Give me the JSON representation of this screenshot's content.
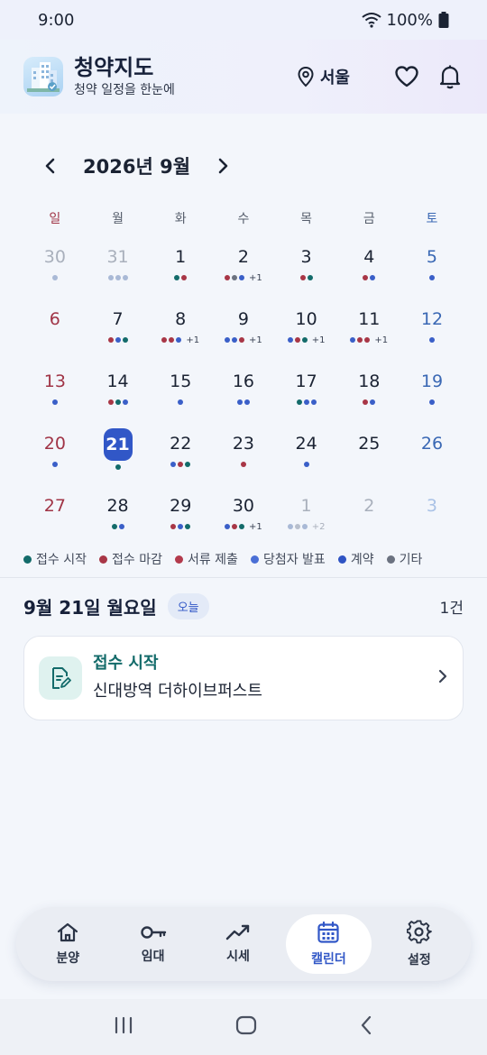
{
  "status": {
    "time": "9:00",
    "battery": "100%"
  },
  "header": {
    "title": "청약지도",
    "subtitle": "청약 일정을 한눈에",
    "location": "서울"
  },
  "calendar": {
    "month_label": "2026년 9월",
    "weekdays": [
      "일",
      "월",
      "화",
      "수",
      "목",
      "금",
      "토"
    ],
    "weeks": [
      [
        {
          "d": "30",
          "other": true,
          "dots": [
            "#a9b9d6"
          ]
        },
        {
          "d": "31",
          "other": true,
          "dots": [
            "#a9b9d6",
            "#a9b9d6",
            "#a9b9d6"
          ]
        },
        {
          "d": "1",
          "dots": [
            "#136b6a",
            "#a83646"
          ]
        },
        {
          "d": "2",
          "dots": [
            "#a83646",
            "#6b7280",
            "#3a5fc8"
          ],
          "more": "+1"
        },
        {
          "d": "3",
          "dots": [
            "#a83646",
            "#136b6a"
          ]
        },
        {
          "d": "4",
          "dots": [
            "#a83646",
            "#3a5fc8"
          ]
        },
        {
          "d": "5",
          "dots": [
            "#3a5fc8"
          ]
        }
      ],
      [
        {
          "d": "6",
          "dots": []
        },
        {
          "d": "7",
          "dots": [
            "#a83646",
            "#3a5fc8",
            "#136b6a"
          ]
        },
        {
          "d": "8",
          "dots": [
            "#a83646",
            "#a83646",
            "#3a5fc8"
          ],
          "more": "+1"
        },
        {
          "d": "9",
          "dots": [
            "#3a5fc8",
            "#3a5fc8",
            "#a83646"
          ],
          "more": "+1"
        },
        {
          "d": "10",
          "dots": [
            "#3a5fc8",
            "#a83646",
            "#136b6a"
          ],
          "more": "+1"
        },
        {
          "d": "11",
          "dots": [
            "#3a5fc8",
            "#a83646",
            "#a83646"
          ],
          "more": "+1"
        },
        {
          "d": "12",
          "dots": [
            "#3a5fc8"
          ]
        }
      ],
      [
        {
          "d": "13",
          "dots": [
            "#3a5fc8"
          ]
        },
        {
          "d": "14",
          "dots": [
            "#a83646",
            "#136b6a",
            "#3a5fc8"
          ]
        },
        {
          "d": "15",
          "dots": [
            "#3a5fc8"
          ]
        },
        {
          "d": "16",
          "dots": [
            "#3a5fc8",
            "#3a5fc8"
          ]
        },
        {
          "d": "17",
          "dots": [
            "#136b6a",
            "#3a5fc8",
            "#3a5fc8"
          ]
        },
        {
          "d": "18",
          "dots": [
            "#a83646",
            "#3a5fc8"
          ]
        },
        {
          "d": "19",
          "dots": [
            "#3a5fc8"
          ]
        }
      ],
      [
        {
          "d": "20",
          "dots": [
            "#3a5fc8"
          ]
        },
        {
          "d": "21",
          "today": true,
          "dots": [
            "#136b6a"
          ]
        },
        {
          "d": "22",
          "dots": [
            "#3a5fc8",
            "#a83646",
            "#136b6a"
          ]
        },
        {
          "d": "23",
          "dots": [
            "#a83646"
          ]
        },
        {
          "d": "24",
          "dots": [
            "#3a5fc8"
          ]
        },
        {
          "d": "25",
          "dots": []
        },
        {
          "d": "26",
          "dots": []
        }
      ],
      [
        {
          "d": "27",
          "dots": []
        },
        {
          "d": "28",
          "dots": [
            "#136b6a",
            "#3a5fc8"
          ]
        },
        {
          "d": "29",
          "dots": [
            "#a83646",
            "#3a5fc8",
            "#136b6a"
          ]
        },
        {
          "d": "30",
          "dots": [
            "#3a5fc8",
            "#a83646",
            "#136b6a"
          ],
          "more": "+1"
        },
        {
          "d": "1",
          "other": true,
          "dots": [
            "#a9b9d6",
            "#b8bfcc",
            "#a9b9d6"
          ],
          "more": "+2"
        },
        {
          "d": "2",
          "other": true,
          "dots": []
        },
        {
          "d": "3",
          "other": true,
          "dots": []
        }
      ]
    ]
  },
  "legend": [
    {
      "label": "접수 시작",
      "color": "#136b6a"
    },
    {
      "label": "접수 마감",
      "color": "#a83646"
    },
    {
      "label": "서류 제출",
      "color": "#b33a4c"
    },
    {
      "label": "당첨자 발표",
      "color": "#4a6fd6"
    },
    {
      "label": "계약",
      "color": "#2f54c4"
    },
    {
      "label": "기타",
      "color": "#6b7280"
    }
  ],
  "selected_day": {
    "title": "9월 21일 월요일",
    "badge": "오늘",
    "count": "1건"
  },
  "event": {
    "type": "접수 시작",
    "name": "신대방역 더하이브퍼스트"
  },
  "tabs": [
    {
      "label": "분양",
      "icon": "home-icon"
    },
    {
      "label": "임대",
      "icon": "key-icon"
    },
    {
      "label": "시세",
      "icon": "trend-icon"
    },
    {
      "label": "캘린더",
      "icon": "calendar-icon",
      "active": true
    },
    {
      "label": "설정",
      "icon": "gear-icon"
    }
  ]
}
